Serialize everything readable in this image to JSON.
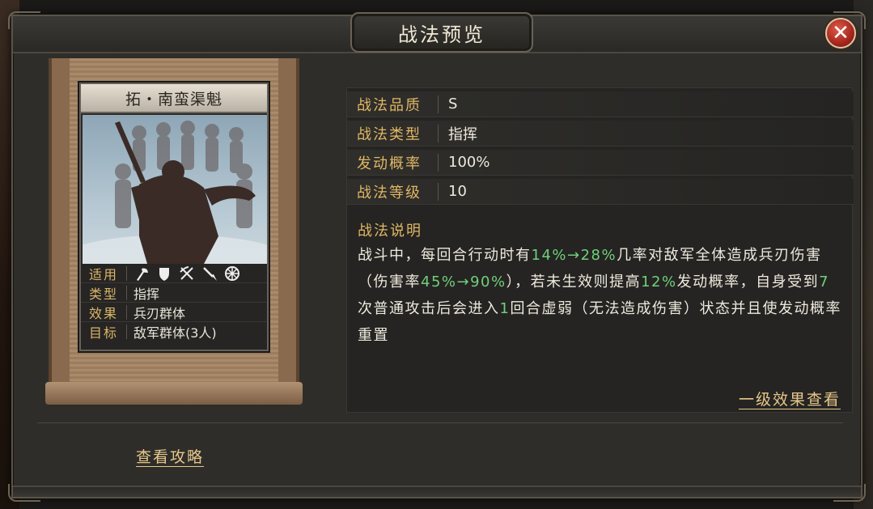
{
  "dialog": {
    "title": "战法预览",
    "close_label": "✕"
  },
  "card": {
    "name": "拓・南蛮渠魁",
    "rows": [
      {
        "label": "适用",
        "icons": [
          "axe-icon",
          "shield-icon",
          "crossed-bow-icon",
          "spear-icon",
          "wheel-icon"
        ]
      },
      {
        "label": "类型",
        "value": "指挥"
      },
      {
        "label": "效果",
        "value": "兵刃群体"
      },
      {
        "label": "目标",
        "value": "敌军群体(3人)"
      }
    ]
  },
  "properties": [
    {
      "label": "战法品质",
      "value": "S"
    },
    {
      "label": "战法类型",
      "value": "指挥"
    },
    {
      "label": "发动概率",
      "value": "100%"
    },
    {
      "label": "战法等级",
      "value": "10"
    }
  ],
  "description": {
    "title": "战法说明",
    "segments": [
      {
        "text": "战斗中，每回合行动时有",
        "highlight": false
      },
      {
        "text": "14%→28%",
        "highlight": true
      },
      {
        "text": "几率对敌军全体造成兵刃伤害（伤害率",
        "highlight": false
      },
      {
        "text": "45%→90%",
        "highlight": true
      },
      {
        "text": "），若未生效则提高",
        "highlight": false
      },
      {
        "text": "12%",
        "highlight": true
      },
      {
        "text": "发动概率，自身受到",
        "highlight": false
      },
      {
        "text": "7",
        "highlight": true
      },
      {
        "text": "次普通攻击后会进入",
        "highlight": false
      },
      {
        "text": "1",
        "highlight": true
      },
      {
        "text": "回合虚弱（无法造成伤害）状态并且使发动概率重置",
        "highlight": false
      }
    ],
    "highlight_color": "#6fd07a"
  },
  "links": {
    "effect": "一级效果查看",
    "guide": "查看攻略"
  }
}
